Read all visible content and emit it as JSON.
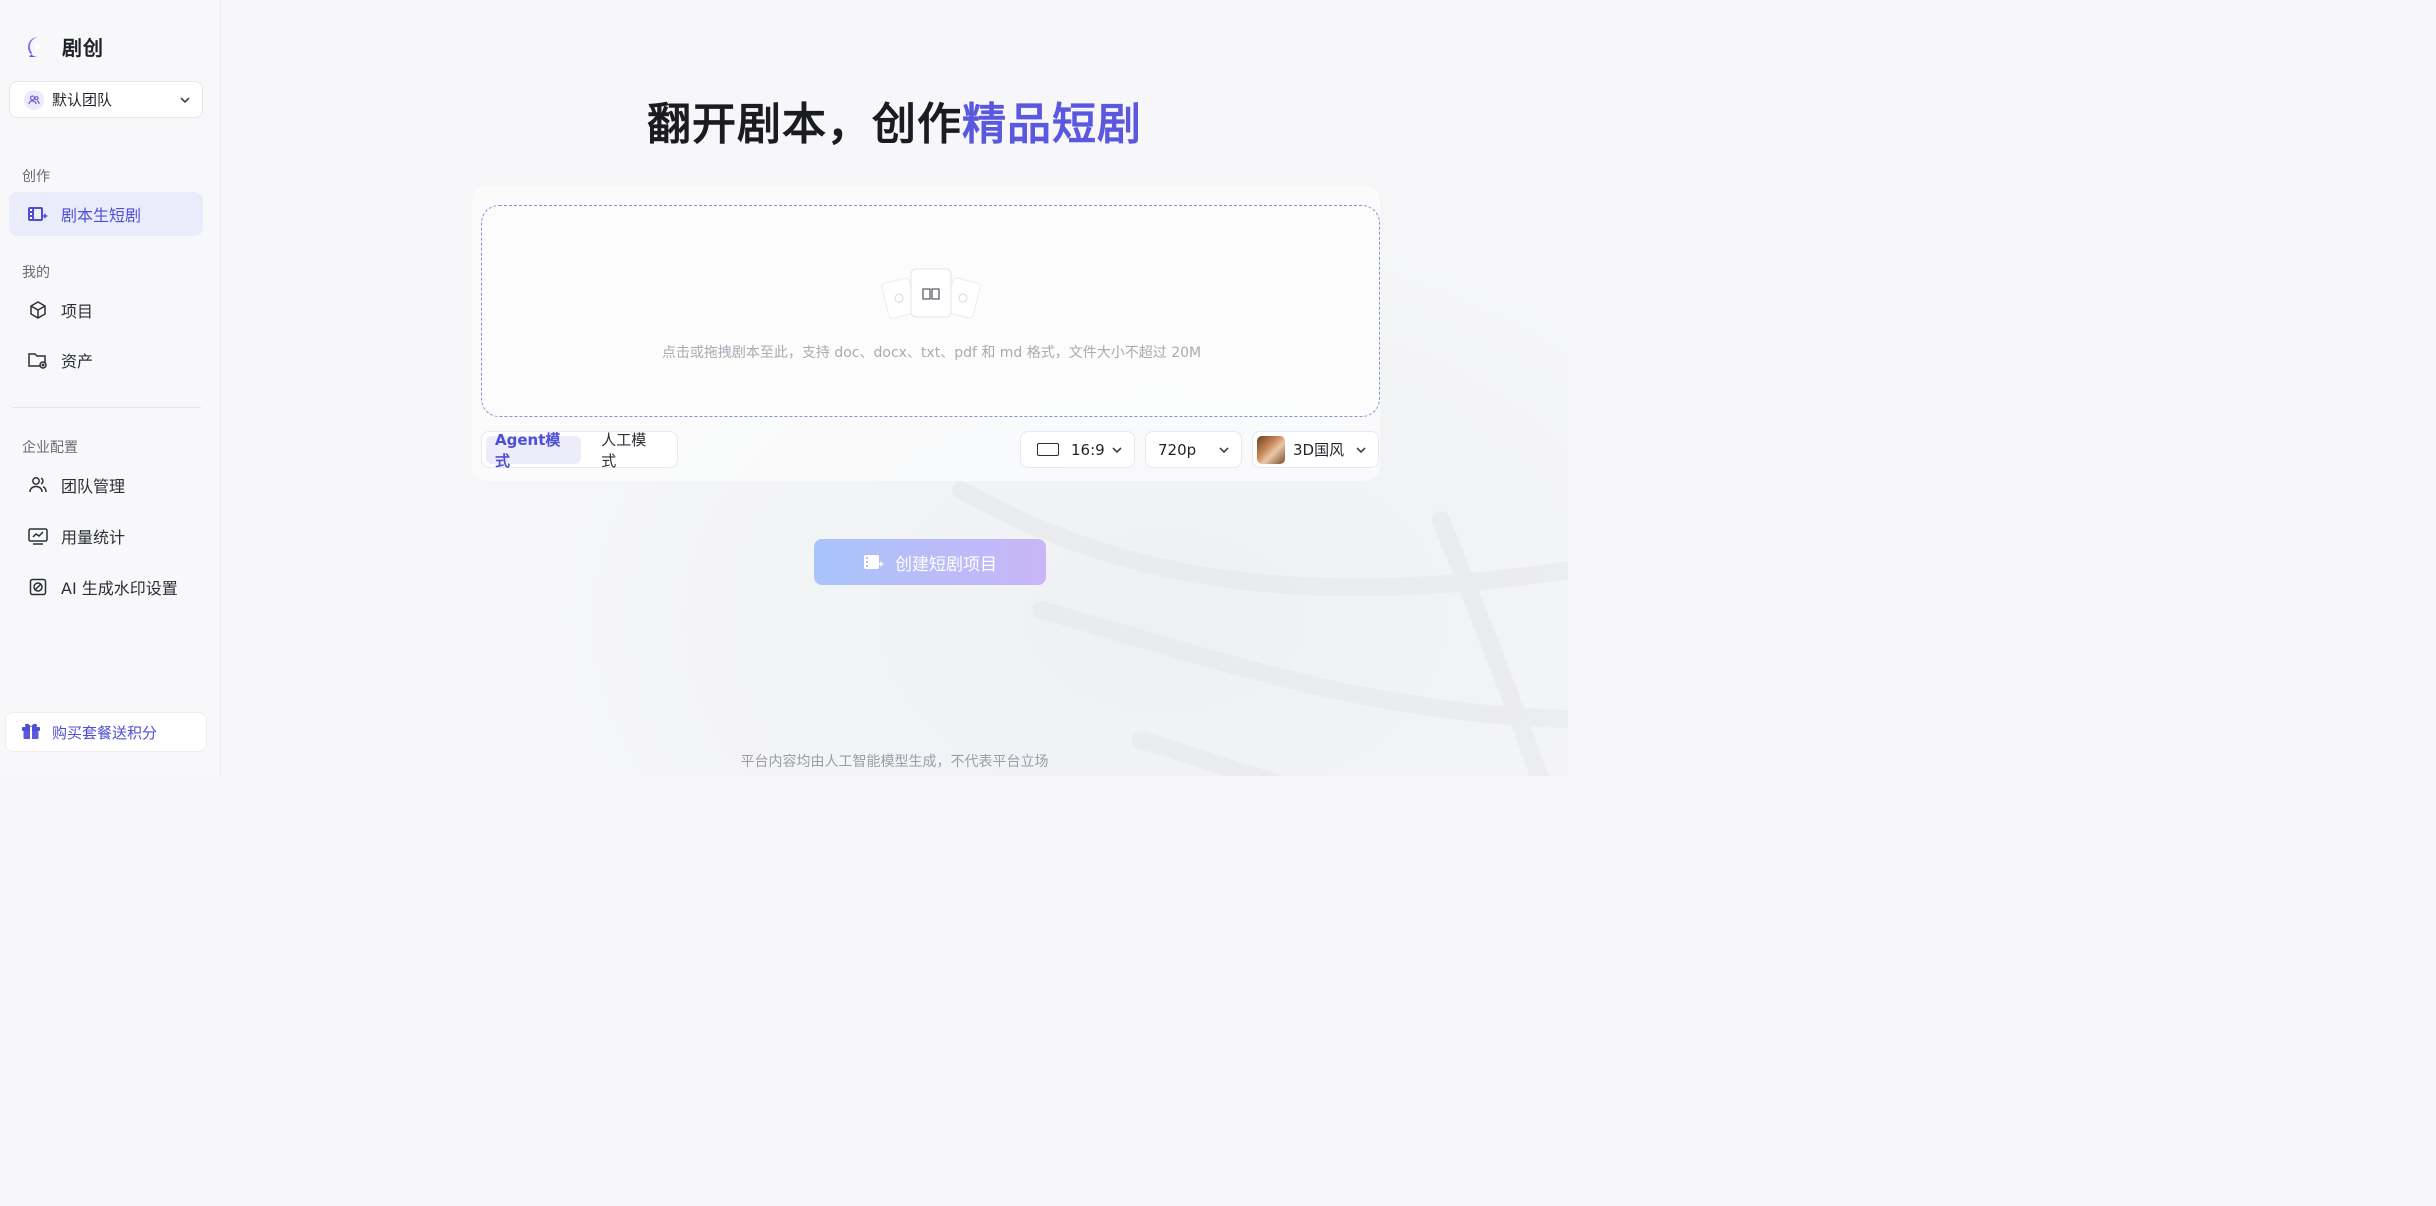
{
  "brand": {
    "name": "剧创"
  },
  "team": {
    "name": "默认团队"
  },
  "sidebar": {
    "sections": {
      "create": "创作",
      "mine": "我的",
      "enterprise": "企业配置"
    },
    "items": [
      {
        "label": "剧本生短剧",
        "icon": "film-sparkle-icon",
        "active": true
      },
      {
        "label": "项目",
        "icon": "cube-icon"
      },
      {
        "label": "资产",
        "icon": "folder-plus-icon"
      },
      {
        "label": "团队管理",
        "icon": "users-icon"
      },
      {
        "label": "用量统计",
        "icon": "monitor-chart-icon"
      },
      {
        "label": "AI 生成水印设置",
        "icon": "watermark-icon"
      }
    ],
    "promo": "购买套餐送积分"
  },
  "main": {
    "headline": {
      "prefix": "翻开剧本，创作",
      "accent": "精品短剧"
    },
    "upload_hint": "点击或拖拽剧本至此，支持 doc、docx、txt、pdf 和 md 格式，文件大小不超过 20M",
    "modes": [
      {
        "label": "Agent模式",
        "active": true
      },
      {
        "label": "人工模式",
        "active": false
      }
    ],
    "aspect_ratio": "16:9",
    "resolution": "720p",
    "style": "3D国风",
    "create_button": "创建短剧项目",
    "footer": "平台内容均由人工智能模型生成，不代表平台立场"
  },
  "colors": {
    "accent": "#5b58e0",
    "active_bg": "#ebecfb"
  }
}
